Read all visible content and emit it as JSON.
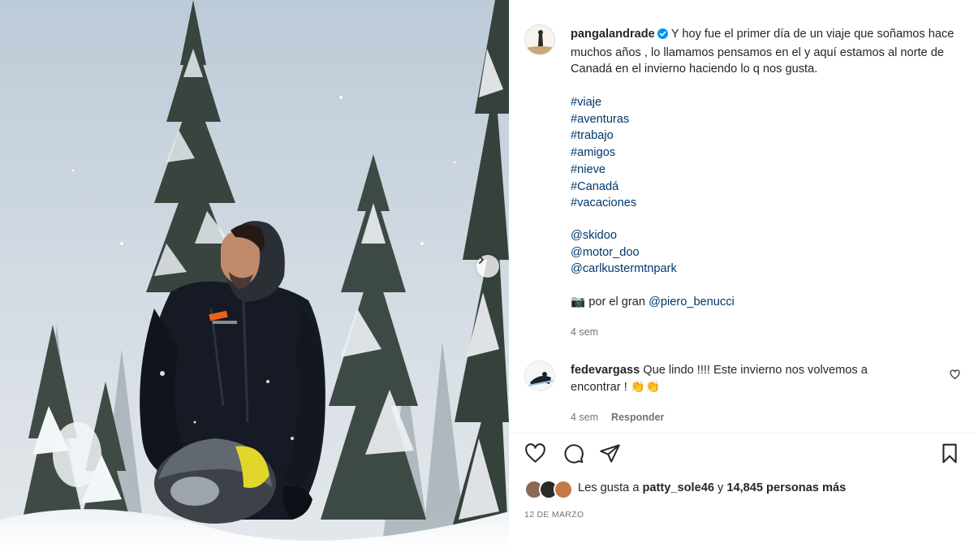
{
  "post": {
    "username": "pangalandrade",
    "caption": "Y hoy fue el primer día de un viaje que soñamos hace muchos años , lo llamamos pensamos en el y aquí estamos al norte de Canadá en el invierno haciendo lo q nos gusta.",
    "hashtags": [
      "#viaje",
      "#aventuras",
      "#trabajo",
      "#amigos",
      "#nieve",
      "#Canadá",
      "#vacaciones"
    ],
    "mentions": [
      "@skidoo",
      "@motor_doo",
      "@carlkustermtnpark"
    ],
    "credit_emoji": "📷",
    "credit_text": " por el gran ",
    "credit_user": "@piero_benucci",
    "time": "4 sem"
  },
  "comment": {
    "username": "fedevargass",
    "text": " Que lindo !!!! Este invierno nos volvemos a encontrar ! 👏👏",
    "time": "4 sem",
    "reply_label": "Responder"
  },
  "likes": {
    "prefix": "Les gusta a ",
    "user": "patty_sole46",
    "middle": " y ",
    "count": "14,845 personas más"
  },
  "date": "12 DE MARZO",
  "icons": {
    "like": "heart-icon",
    "comment": "comment-icon",
    "share": "paper-plane-icon",
    "save": "bookmark-icon",
    "next": "chevron-right-icon",
    "verified": "verified-badge-icon"
  },
  "colors": {
    "link": "#00376b",
    "verified": "#0095f6",
    "muted": "#737373"
  }
}
